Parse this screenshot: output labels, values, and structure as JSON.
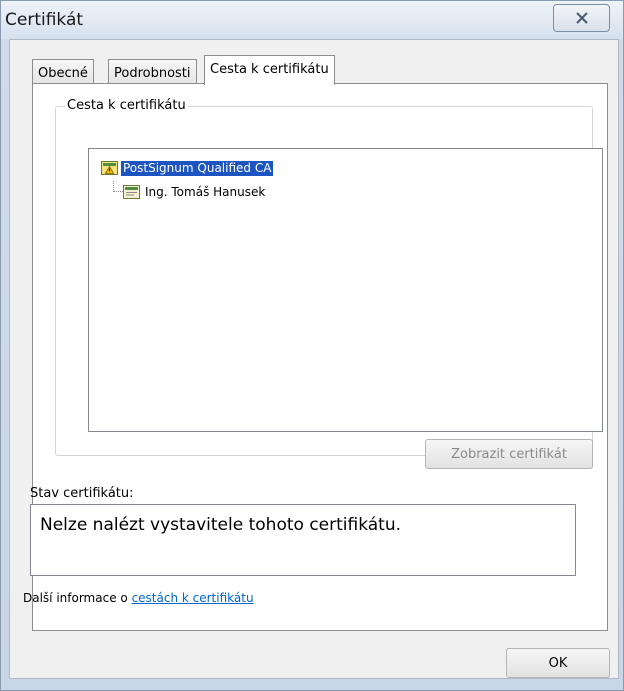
{
  "window": {
    "title": "Certifikát"
  },
  "tabs": [
    {
      "label": "Obecné"
    },
    {
      "label": "Podrobnosti"
    },
    {
      "label": "Cesta k certifikátu"
    }
  ],
  "certification_path": {
    "group_label": "Cesta k certifikátu",
    "tree": [
      {
        "label": "PostSignum Qualified CA",
        "selected": true,
        "level": 0,
        "icon": "certificate-warning-icon"
      },
      {
        "label": "Ing. Tomáš Hanusek",
        "selected": false,
        "level": 1,
        "icon": "certificate-icon"
      }
    ],
    "view_button": "Zobrazit certifikát"
  },
  "status": {
    "label": "Stav certifikátu:",
    "text": "Nelze nalézt vystavitele tohoto certifikátu."
  },
  "info": {
    "prefix": "Další informace o ",
    "link": "cestách k certifikátu"
  },
  "ok_button": "OK",
  "colors": {
    "selection": "#1c55c2",
    "link": "#0066cc",
    "frame": "#c9d6e6"
  }
}
